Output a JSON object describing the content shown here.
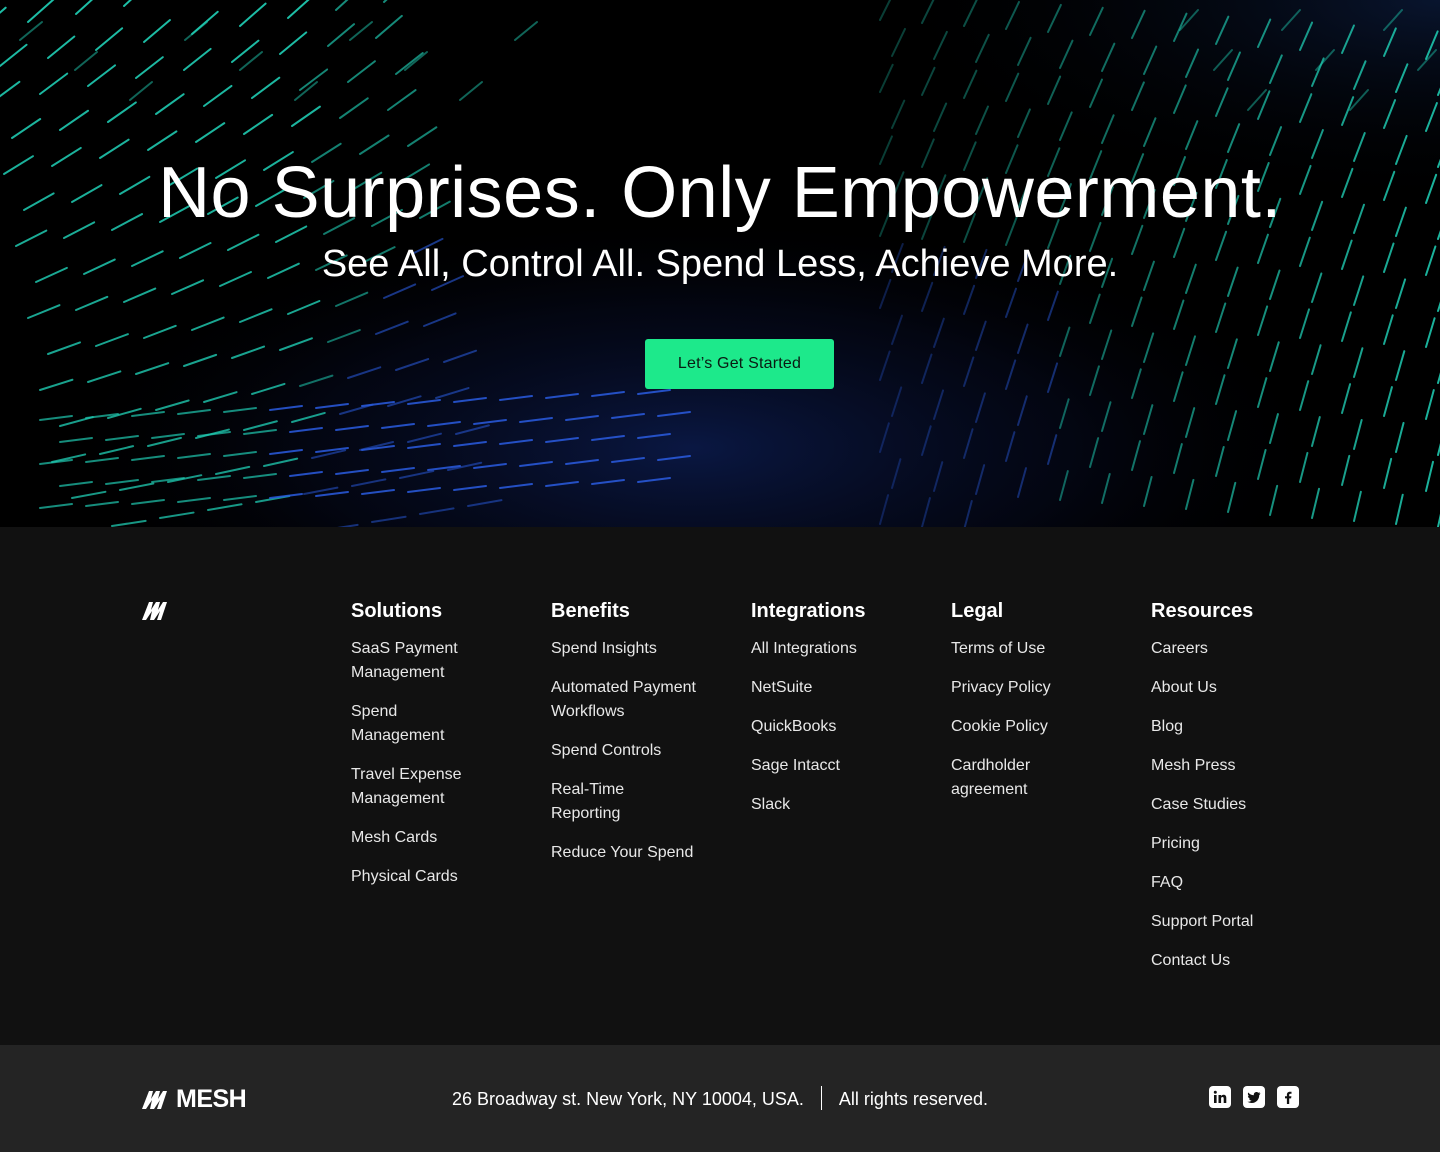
{
  "hero": {
    "title": "No Surprises. Only Empowerment.",
    "subtitle": "See All, Control All. Spend Less, Achieve More.",
    "cta_label": "Let’s Get Started"
  },
  "colors": {
    "accent": "#1de98b",
    "stripe_teal": "#1fc9b0",
    "stripe_blue": "#2a5ce0",
    "footer_bg": "#111111",
    "bottom_bar_bg": "#242424"
  },
  "footer": {
    "columns": [
      {
        "heading": "Solutions",
        "items": [
          "SaaS Payment\nManagement",
          "Spend\nManagement",
          "Travel Expense\nManagement",
          "Mesh Cards",
          "Physical Cards"
        ]
      },
      {
        "heading": "Benefits",
        "items": [
          "Spend Insights",
          "Automated Payment\nWorkflows",
          "Spend Controls",
          "Real-Time\nReporting",
          "Reduce Your Spend"
        ]
      },
      {
        "heading": "Integrations",
        "items": [
          "All Integrations",
          "NetSuite",
          "QuickBooks",
          "Sage Intacct",
          "Slack"
        ]
      },
      {
        "heading": "Legal",
        "items": [
          "Terms of Use",
          "Privacy Policy",
          "Cookie Policy",
          "Cardholder\nagreement"
        ]
      },
      {
        "heading": "Resources",
        "items": [
          "Careers",
          "About Us",
          "Blog",
          "Mesh Press",
          "Case Studies",
          "Pricing",
          "FAQ",
          "Support Portal",
          "Contact Us"
        ]
      }
    ]
  },
  "bottom_bar": {
    "brand": "MESH",
    "address": "26 Broadway st. New York, NY 10004, USA.",
    "rights": "All rights reserved.",
    "socials": [
      "linkedin-icon",
      "twitter-icon",
      "facebook-icon"
    ]
  }
}
